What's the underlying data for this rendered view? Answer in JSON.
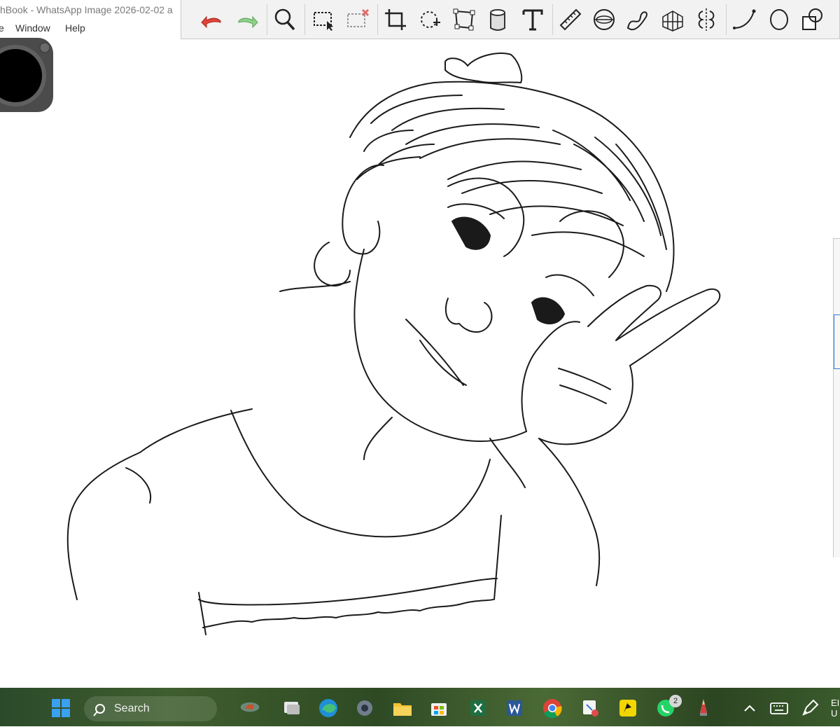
{
  "window": {
    "title": "hBook - WhatsApp Image 2026-02-02 a"
  },
  "menu": {
    "items": [
      "e",
      "Window",
      "Help"
    ]
  },
  "toolbar": {
    "tools": [
      "undo-icon",
      "redo-icon",
      "zoom-icon",
      "selection-icon",
      "clear-selection-icon",
      "crop-icon",
      "transform-icon",
      "distort-icon",
      "fill-icon",
      "text-icon",
      "ruler-icon",
      "ellipse-guide-icon",
      "french-curve-icon",
      "perspective-icon",
      "symmetry-icon",
      "curve-icon",
      "ellipse-icon",
      "shapes-icon"
    ],
    "colors": {
      "undo": "#e0443a",
      "redo": "#8fd08a",
      "bg": "#f2f2f2"
    }
  },
  "taskbar": {
    "search_label": "Search",
    "whatsapp_badge": "2",
    "tray_text": "EI\nU",
    "apps": [
      "windows-start-icon",
      "search-icon",
      "news-widget-icon",
      "task-view-icon",
      "edge-icon",
      "settings-icon",
      "file-explorer-icon",
      "microsoft-store-icon",
      "excel-icon",
      "word-icon",
      "chrome-icon",
      "snipping-tool-icon",
      "app-yellow-icon",
      "whatsapp-icon",
      "sketch-pencil-icon",
      "show-hidden-icons",
      "keyboard-icon",
      "pen-icon"
    ]
  }
}
